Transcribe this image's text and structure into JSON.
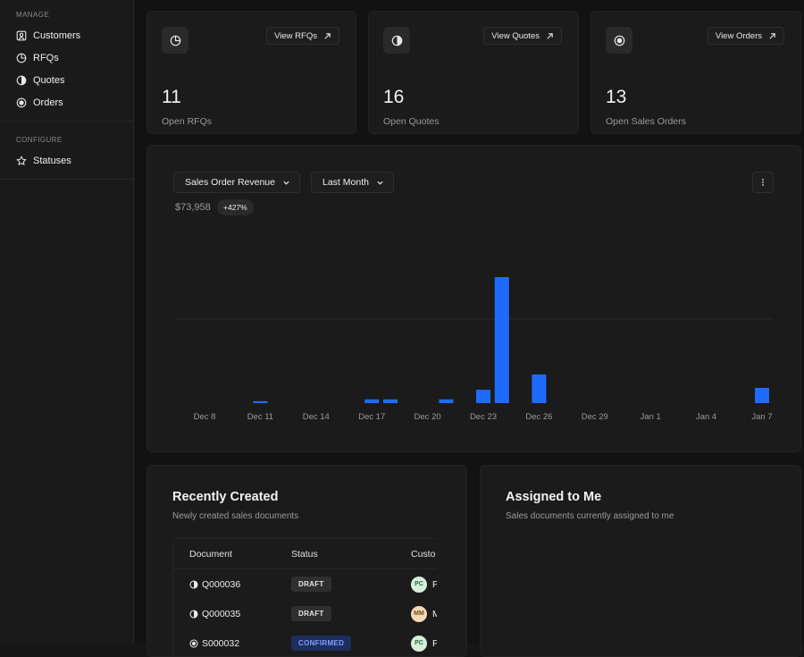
{
  "sidebar": {
    "sections": [
      {
        "heading": "MANAGE",
        "items": [
          {
            "label": "Customers",
            "icon": "customer-icon"
          },
          {
            "label": "RFQs",
            "icon": "pie-icon"
          },
          {
            "label": "Quotes",
            "icon": "half-circle-icon"
          },
          {
            "label": "Orders",
            "icon": "target-icon"
          }
        ]
      },
      {
        "heading": "CONFIGURE",
        "items": [
          {
            "label": "Statuses",
            "icon": "star-icon"
          }
        ]
      }
    ]
  },
  "stats": [
    {
      "link": "View RFQs",
      "value": "11",
      "label": "Open RFQs",
      "icon": "pie-icon"
    },
    {
      "link": "View Quotes",
      "value": "16",
      "label": "Open Quotes",
      "icon": "half-circle-icon"
    },
    {
      "link": "View Orders",
      "value": "13",
      "label": "Open Sales Orders",
      "icon": "target-icon"
    }
  ],
  "chart_panel": {
    "metric_select": "Sales Order Revenue",
    "period_select": "Last Month",
    "total": "$73,958",
    "change": "+427%"
  },
  "chart_data": {
    "type": "bar",
    "x_tick_labels": [
      "Dec 8",
      "Dec 11",
      "Dec 14",
      "Dec 17",
      "Dec 20",
      "Dec 23",
      "Dec 26",
      "Dec 29",
      "Jan 1",
      "Jan 4",
      "Jan 7"
    ],
    "days": [
      "Dec 8",
      "Dec 9",
      "Dec 10",
      "Dec 11",
      "Dec 12",
      "Dec 13",
      "Dec 14",
      "Dec 15",
      "Dec 16",
      "Dec 17",
      "Dec 18",
      "Dec 19",
      "Dec 20",
      "Dec 21",
      "Dec 22",
      "Dec 23",
      "Dec 24",
      "Dec 25",
      "Dec 26",
      "Dec 27",
      "Dec 28",
      "Dec 29",
      "Dec 30",
      "Dec 31",
      "Jan 1",
      "Jan 2",
      "Jan 3",
      "Jan 4",
      "Jan 5",
      "Jan 6",
      "Jan 7"
    ],
    "values": [
      0,
      0,
      0,
      500,
      0,
      0,
      0,
      0,
      0,
      1000,
      1000,
      0,
      0,
      1000,
      0,
      3500,
      33000,
      0,
      7500,
      0,
      0,
      0,
      0,
      0,
      0,
      0,
      0,
      0,
      0,
      0,
      4000
    ],
    "ylim": [
      0,
      44000
    ],
    "gridline": 22000,
    "bar_color": "#1f6bff",
    "grid": true
  },
  "recent": {
    "title": "Recently Created",
    "subtitle": "Newly created sales documents",
    "columns": [
      "Document",
      "Status",
      "Custo"
    ],
    "rows": [
      {
        "doc": "Q000036",
        "icon": "half-circle-icon",
        "status": "DRAFT",
        "kind": "draft",
        "initials": "PC",
        "av_bg": "#d6eedb",
        "av_fg": "#2a6b3a",
        "cust": "P"
      },
      {
        "doc": "Q000035",
        "icon": "half-circle-icon",
        "status": "DRAFT",
        "kind": "draft",
        "initials": "MM",
        "av_bg": "#f3d9b8",
        "av_fg": "#7a4a12",
        "cust": "M"
      },
      {
        "doc": "S000032",
        "icon": "target-icon",
        "status": "CONFIRMED",
        "kind": "confirmed",
        "initials": "PC",
        "av_bg": "#d6eedb",
        "av_fg": "#2a6b3a",
        "cust": "P"
      }
    ]
  },
  "assigned": {
    "title": "Assigned to Me",
    "subtitle": "Sales documents currently assigned to me"
  }
}
